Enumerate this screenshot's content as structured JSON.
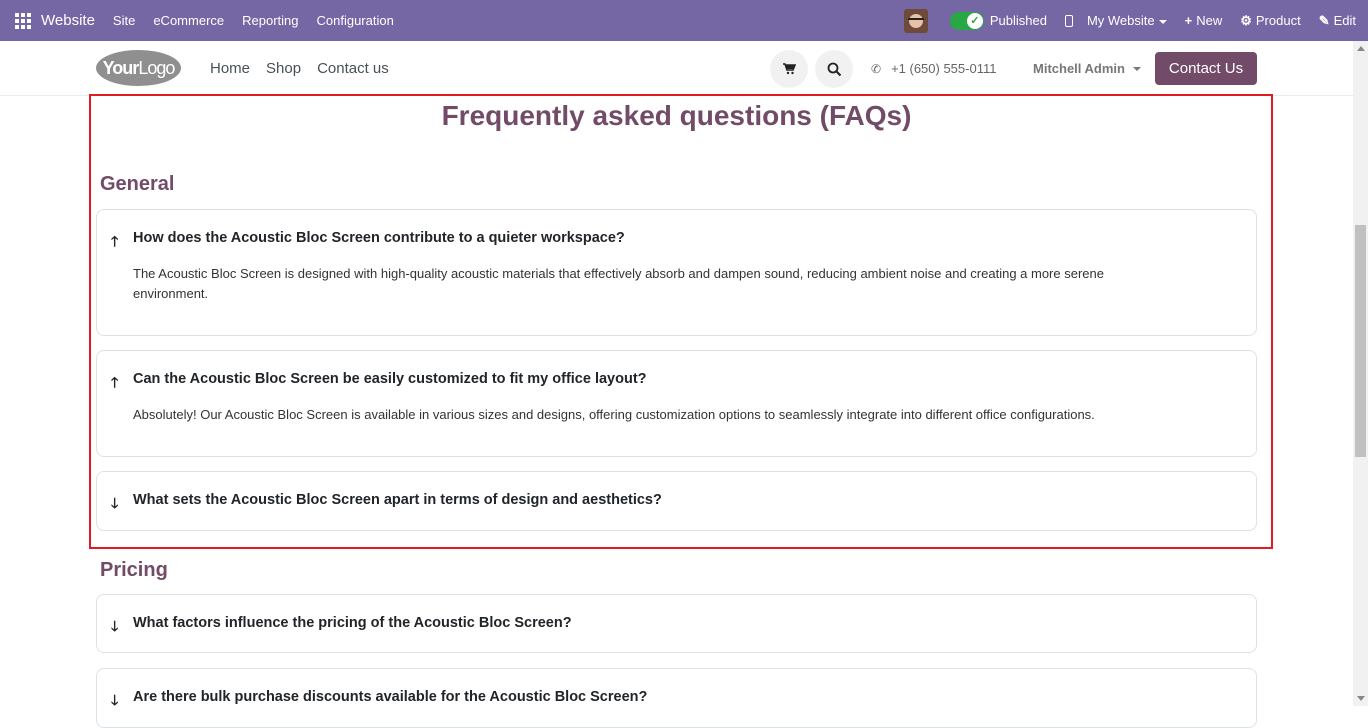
{
  "adminbar": {
    "brand": "Website",
    "menus": [
      "Site",
      "eCommerce",
      "Reporting",
      "Configuration"
    ],
    "published_label": "Published",
    "my_website_label": "My Website",
    "new_label": "New",
    "product_label": "Product",
    "edit_label": "Edit",
    "color": "#7467a4"
  },
  "header": {
    "logo_text_bold": "Your",
    "logo_text_rest": "Logo",
    "nav": [
      "Home",
      "Shop",
      "Contact us"
    ],
    "phone": "+1 (650) 555-0111",
    "user": "Mitchell Admin",
    "contact_button": "Contact Us",
    "accent": "#714b67"
  },
  "faq": {
    "title": "Frequently asked questions (FAQs)",
    "sections": [
      {
        "title": "General",
        "items": [
          {
            "question": "How does the Acoustic Bloc Screen contribute to a quieter workspace?",
            "answer": "The Acoustic Bloc Screen is designed with high-quality acoustic materials that effectively absorb and dampen sound, reducing ambient noise and creating a more serene environment.",
            "expanded": true
          },
          {
            "question": "Can the Acoustic Bloc Screen be easily customized to fit my office layout?",
            "answer": "Absolutely! Our Acoustic Bloc Screen is available in various sizes and designs, offering customization options to seamlessly integrate into different office configurations.",
            "expanded": true
          },
          {
            "question": "What sets the Acoustic Bloc Screen apart in terms of design and aesthetics?",
            "expanded": false
          }
        ]
      },
      {
        "title": "Pricing",
        "items": [
          {
            "question": "What factors influence the pricing of the Acoustic Bloc Screen?",
            "expanded": false
          },
          {
            "question": "Are there bulk purchase discounts available for the Acoustic Bloc Screen?",
            "expanded": false
          }
        ]
      }
    ]
  }
}
